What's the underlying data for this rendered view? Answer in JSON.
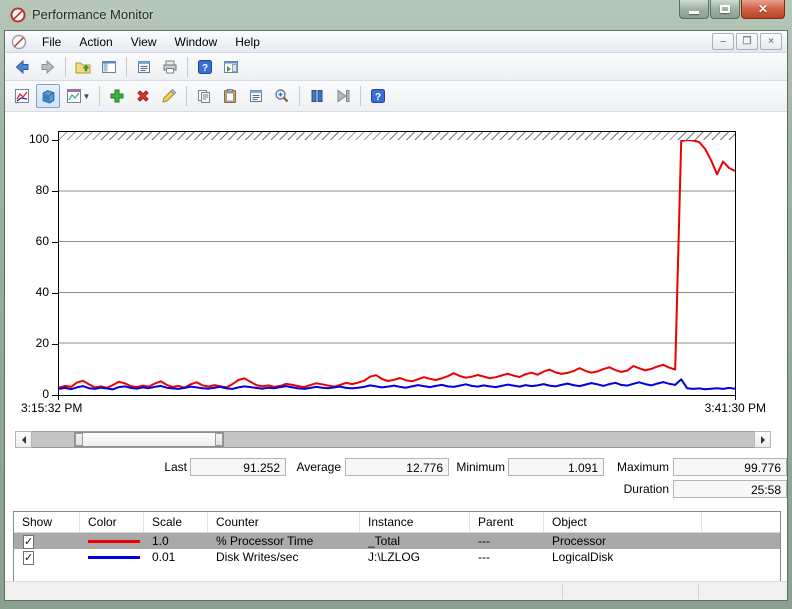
{
  "window": {
    "title": "Performance Monitor"
  },
  "menu": {
    "items": [
      "File",
      "Action",
      "View",
      "Window",
      "Help"
    ]
  },
  "toolbar_main": {
    "buttons": [
      "back",
      "forward",
      "up-one-level",
      "show-hide-console-tree",
      "properties",
      "print",
      "help",
      "show-hide-action-pane"
    ]
  },
  "toolbar_perfmon": {
    "buttons": [
      "view-current-activity",
      "view-log-data",
      "change-graph-type",
      "add",
      "delete",
      "highlight",
      "copy-properties",
      "paste-counter-list",
      "properties",
      "zoom",
      "freeze-display",
      "update-data",
      "help"
    ],
    "active_button": "view-log-data"
  },
  "chart_data": {
    "type": "line",
    "title": "",
    "xlabel": "",
    "ylabel": "",
    "ylim": [
      0,
      100
    ],
    "grid": true,
    "yticks": [
      "100",
      "80",
      "60",
      "40",
      "20",
      "0"
    ],
    "x_start": "3:15:32 PM",
    "x_end": "3:41:30 PM",
    "series": [
      {
        "name": "% Processor Time",
        "color": "#ee0000",
        "values": [
          2.5,
          3.2,
          2.8,
          4.5,
          5.2,
          3.8,
          2.6,
          3.0,
          2.4,
          3.5,
          4.8,
          4.2,
          3.1,
          2.7,
          3.3,
          2.9,
          4.1,
          5.0,
          3.6,
          2.8,
          3.2,
          2.5,
          3.8,
          4.6,
          3.4,
          2.9,
          3.5,
          3.0,
          2.6,
          3.9,
          5.5,
          6.2,
          4.8,
          3.5,
          3.0,
          3.4,
          2.8,
          3.2,
          4.0,
          3.6,
          3.1,
          2.7,
          3.5,
          4.2,
          3.8,
          3.3,
          2.9,
          3.6,
          4.4,
          3.9,
          4.5,
          5.2,
          6.8,
          7.4,
          5.9,
          5.1,
          5.6,
          6.3,
          5.4,
          5.0,
          5.8,
          6.6,
          6.0,
          5.5,
          6.2,
          7.0,
          8.2,
          7.1,
          6.4,
          6.8,
          7.5,
          6.9,
          6.2,
          6.6,
          7.3,
          8.0,
          7.2,
          6.7,
          7.8,
          8.4,
          7.6,
          8.8,
          9.6,
          8.5,
          7.9,
          8.3,
          9.0,
          10.2,
          9.1,
          8.4,
          8.9,
          9.8,
          10.5,
          9.4,
          8.7,
          9.2,
          11.0,
          10.1,
          9.3,
          9.9,
          10.8,
          11.5,
          10.4,
          9.6,
          99.6,
          100,
          99.8,
          99.2,
          96.5,
          92.0,
          86.5,
          91.5,
          89.0,
          87.8
        ]
      },
      {
        "name": "Disk Writes/sec",
        "color": "#0000e0",
        "values": [
          2.0,
          2.4,
          1.9,
          2.6,
          3.1,
          2.3,
          2.0,
          2.5,
          2.2,
          1.8,
          2.7,
          3.0,
          2.4,
          2.1,
          2.6,
          2.3,
          2.8,
          3.2,
          2.5,
          2.2,
          2.0,
          2.4,
          2.9,
          2.6,
          2.3,
          2.1,
          2.5,
          2.8,
          2.2,
          2.0,
          2.6,
          3.0,
          2.7,
          2.4,
          2.1,
          2.5,
          2.3,
          2.7,
          3.1,
          2.6,
          2.2,
          2.0,
          2.4,
          2.8,
          2.5,
          2.3,
          2.6,
          2.9,
          2.4,
          2.2,
          2.5,
          2.8,
          3.4,
          3.0,
          2.6,
          2.9,
          3.3,
          2.8,
          2.5,
          3.0,
          3.5,
          3.1,
          2.7,
          3.2,
          3.6,
          3.0,
          2.8,
          3.3,
          3.8,
          3.2,
          2.9,
          3.4,
          3.0,
          2.7,
          3.2,
          3.7,
          3.3,
          2.9,
          3.5,
          3.1,
          3.4,
          3.9,
          3.3,
          3.0,
          3.6,
          4.1,
          3.5,
          3.1,
          3.7,
          4.3,
          3.8,
          3.2,
          3.9,
          4.4,
          3.6,
          3.3,
          4.0,
          4.6,
          3.9,
          3.4,
          4.1,
          4.7,
          4.0,
          3.6,
          5.8,
          2.3,
          2.0,
          2.2,
          1.9,
          2.1,
          2.3,
          2.0,
          2.4,
          2.1
        ]
      }
    ]
  },
  "stats": {
    "last_label": "Last",
    "last": "91.252",
    "average_label": "Average",
    "average": "12.776",
    "minimum_label": "Minimum",
    "minimum": "1.091",
    "maximum_label": "Maximum",
    "maximum": "99.776",
    "duration_label": "Duration",
    "duration": "25:58"
  },
  "table": {
    "columns": [
      "Show",
      "Color",
      "Scale",
      "Counter",
      "Instance",
      "Parent",
      "Object"
    ],
    "rows": [
      {
        "show": true,
        "color": "#ee0000",
        "scale": "1.0",
        "counter": "% Processor Time",
        "instance": "_Total",
        "parent": "---",
        "object": "Processor",
        "selected": true
      },
      {
        "show": true,
        "color": "#0000e0",
        "scale": "0.01",
        "counter": "Disk Writes/sec",
        "instance": "J:\\LZLOG",
        "parent": "---",
        "object": "LogicalDisk",
        "selected": false
      }
    ]
  }
}
